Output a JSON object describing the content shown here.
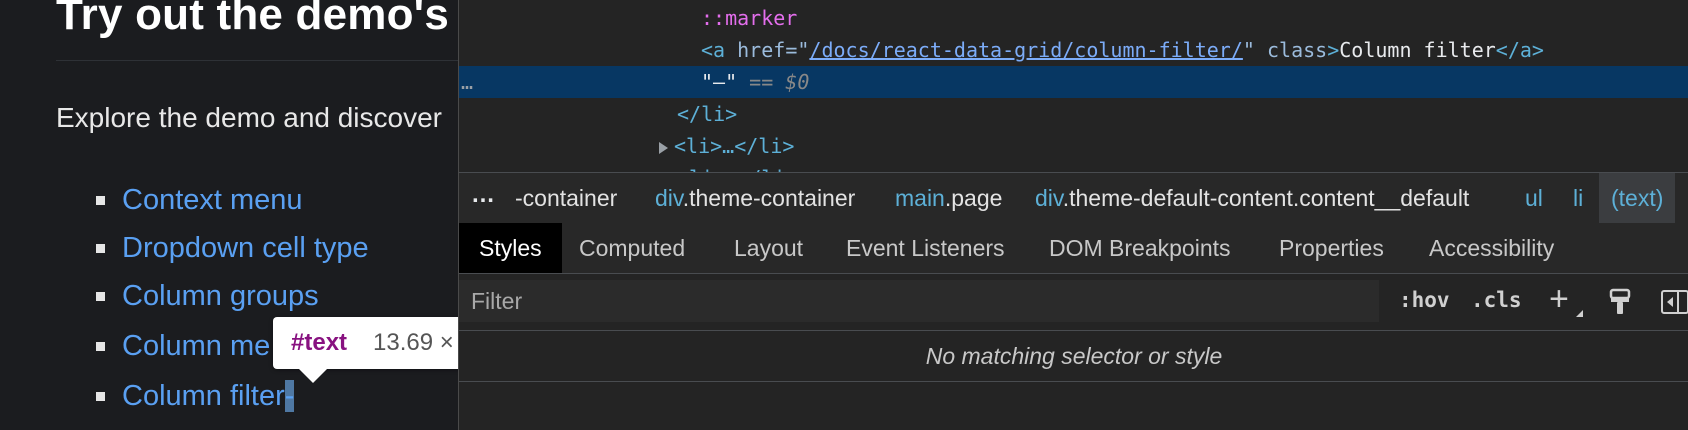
{
  "page": {
    "title": "Try out the demo's",
    "intro": "Explore the demo and discover",
    "features": [
      "Context menu",
      "Dropdown cell type",
      "Column groups",
      "Column me",
      "Column filter"
    ],
    "selected_text": "-"
  },
  "tooltip": {
    "node": "#text",
    "size": "13.69 ×"
  },
  "dom": {
    "marker": "::marker",
    "a_open": "<a",
    "href_attr": "href",
    "href_value": "/docs/react-data-grid/column-filter/",
    "class_attr": "class",
    "link_text": "Column filter",
    "a_close": "</a>",
    "selected_node": "\"–\"",
    "selected_suffix": "== $0",
    "gutter": "…",
    "li_close": "</li>",
    "li_collapsed": "<li>…</li>",
    "li_partial": "<li>…</li>"
  },
  "breadcrumbs": {
    "more": "…",
    "items": [
      {
        "tag": "",
        "cls": "-container"
      },
      {
        "tag": "div",
        "cls": ".theme-container"
      },
      {
        "tag": "main",
        "cls": ".page"
      },
      {
        "tag": "div",
        "cls": ".theme-default-content.content__default"
      },
      {
        "tag": "ul",
        "cls": ""
      },
      {
        "tag": "li",
        "cls": ""
      }
    ],
    "active": "(text)"
  },
  "tabs": [
    "Styles",
    "Computed",
    "Layout",
    "Event Listeners",
    "DOM Breakpoints",
    "Properties",
    "Accessibility"
  ],
  "filter": {
    "placeholder": "Filter",
    "hov": ":hov",
    "cls": ".cls",
    "plus": "+"
  },
  "styles": {
    "empty": "No matching selector or style"
  },
  "colors": {
    "link": "#5aa0f2",
    "selected_row": "#073763",
    "tag": "#5db0d7",
    "pseudo": "#e36eec"
  }
}
